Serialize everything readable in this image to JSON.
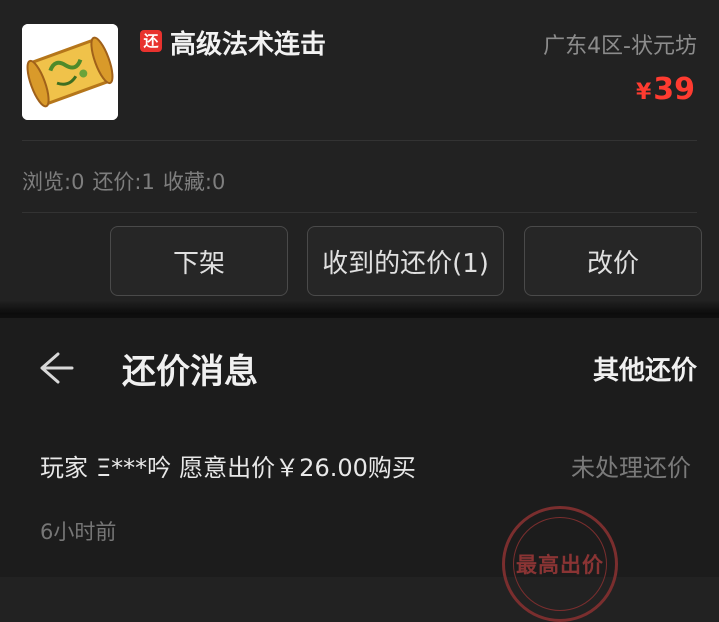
{
  "item": {
    "tag": "还",
    "title": "高级法术连击",
    "server": "广东4区-状元坊",
    "price_currency": "¥",
    "price_value": "39"
  },
  "stats": {
    "views": "浏览:0",
    "offers": "还价:1",
    "favorites": "收藏:0"
  },
  "actions": {
    "delist": "下架",
    "received_offers": "收到的还价(1)",
    "change_price": "改价"
  },
  "sheet": {
    "title": "还价消息",
    "other_offers": "其他还价",
    "offer": {
      "player_label": "玩家",
      "player_name": "Ξ***吟",
      "offer_text": "愿意出价￥26.00购买",
      "status": "未处理还价",
      "time": "6小时前",
      "badge": "最高出价"
    }
  },
  "colors": {
    "background": "#222222",
    "price": "#ff3b30",
    "tag": "#e8322e",
    "stamp": "#7a2e2e"
  },
  "icons": {
    "item": "spell-scroll-icon",
    "back": "back-arrow-icon"
  }
}
